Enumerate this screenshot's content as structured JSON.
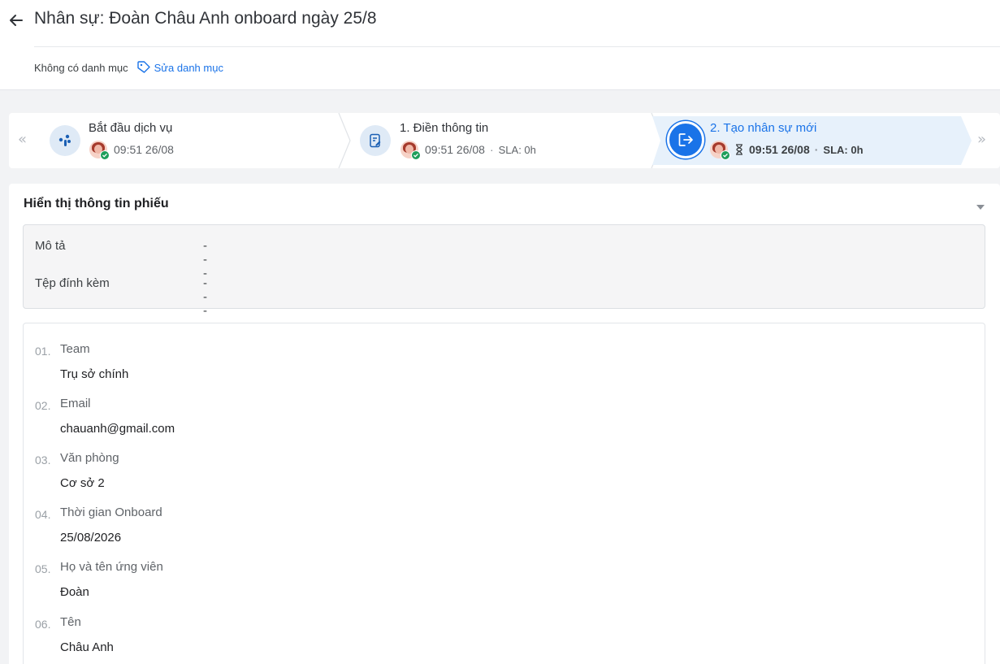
{
  "header": {
    "title": "Nhân sự: Đoàn Châu Anh onboard ngày 25/8",
    "category_none": "Không có danh mục",
    "category_edit": "Sửa danh mục"
  },
  "stepper": {
    "steps": [
      {
        "label": "Bắt đầu dịch vụ",
        "time": "09:51 26/08",
        "sla": "",
        "icon": "rocket-icon"
      },
      {
        "label": "1. Điền thông tin",
        "time": "09:51 26/08",
        "sla": "SLA: 0h",
        "icon": "form-icon"
      },
      {
        "label": "2. Tạo nhân sự mới",
        "time": "09:51 26/08",
        "sla": "SLA: 0h",
        "icon": "export-icon",
        "active": true
      }
    ],
    "sep": "·"
  },
  "panel": {
    "title": "Hiển thị thông tin phiếu",
    "description_label": "Mô tả",
    "description_value": "---",
    "attachment_label": "Tệp đính kèm",
    "attachment_value": "---",
    "fields": [
      {
        "num": "01.",
        "label": "Team",
        "value": "Trụ sở chính"
      },
      {
        "num": "02.",
        "label": "Email",
        "value": "chauanh@gmail.com"
      },
      {
        "num": "03.",
        "label": "Văn phòng",
        "value": "Cơ sở 2"
      },
      {
        "num": "04.",
        "label": "Thời gian Onboard",
        "value": "25/08/2026"
      },
      {
        "num": "05.",
        "label": "Họ và tên ứng viên",
        "value": "Đoàn"
      },
      {
        "num": "06.",
        "label": "Tên",
        "value": "Châu Anh"
      }
    ]
  },
  "colors": {
    "accent": "#1a73e8",
    "success": "#1e9e5a",
    "active_step_bg": "#e7f1fb"
  }
}
